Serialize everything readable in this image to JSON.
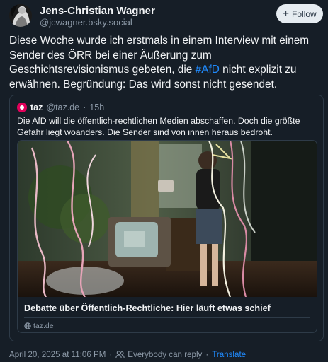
{
  "author": {
    "name": "Jens-Christian Wagner",
    "handle": "@jcwagner.bsky.social",
    "avatar": "person-portrait-avatar"
  },
  "follow_button": {
    "icon": "plus-icon",
    "label": "Follow"
  },
  "post": {
    "text_before": "Diese Woche wurde ich erstmals in einem Interview mit einem Sender des ÖRR bei einer Äußerung zum Geschichtsrevisionismus gebeten, die ",
    "hashtag": "#AfD",
    "text_after": " nicht explizit  zu erwähnen. Begründung: Das wird sonst nicht gesendet."
  },
  "quote": {
    "author_name": "taz",
    "author_handle": "@taz.de",
    "separator": "·",
    "age": "15h",
    "avatar": "taz-logo",
    "text": "Die AfD will die öffentlich-rechtlichen Medien abschaffen. Doch die größte Gefahr liegt woanders. Die Sender sind von innen heraus bedroht.",
    "card": {
      "image": "vintage photo of a woman next to an old television set with party streamers",
      "title": "Debatte über Öffentlich-Rechtliche: Hier läuft etwas schief",
      "domain": "taz.de",
      "domain_icon": "globe-icon"
    }
  },
  "footer": {
    "timestamp": "April 20, 2025 at 11:06 PM",
    "separator": "·",
    "reply_icon": "people-icon",
    "reply_setting": "Everybody can reply",
    "translate": "Translate"
  },
  "colors": {
    "background": "#161e27",
    "text": "#f1f3f5",
    "muted": "#8d9aa8",
    "link": "#208bfe",
    "border": "#2e3b48",
    "taz_brand": "#e1005a"
  }
}
